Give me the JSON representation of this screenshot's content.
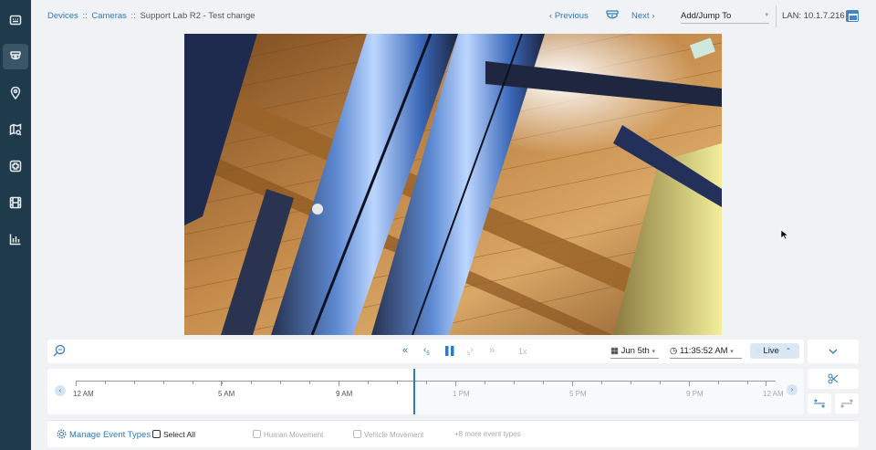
{
  "sidebar": {
    "items": [
      {
        "name": "dashboard",
        "icon": "dashboard-icon"
      },
      {
        "name": "cameras",
        "icon": "camera-icon",
        "active": true
      },
      {
        "name": "locations",
        "icon": "map-pin-icon"
      },
      {
        "name": "map-search",
        "icon": "map-search-icon"
      },
      {
        "name": "health",
        "icon": "medical-plus-icon"
      },
      {
        "name": "footage",
        "icon": "film-icon"
      },
      {
        "name": "analytics",
        "icon": "bar-chart-icon"
      }
    ]
  },
  "header": {
    "breadcrumb": {
      "devices": "Devices",
      "cameras": "Cameras",
      "separator": "::",
      "current": "Support Lab R2 - Test change"
    },
    "previous_label": "Previous",
    "next_label": "Next",
    "jump_label": "Add/Jump To",
    "lan_label": "LAN: 10.1.7.216"
  },
  "controls": {
    "speed": "1x",
    "date": "Jun 5th",
    "time": "11:35:52 AM",
    "live_label": "Live"
  },
  "timeline": {
    "ticks": [
      {
        "label": "12 AM",
        "future": false
      },
      {
        "label": "5 AM",
        "future": false
      },
      {
        "label": "9 AM",
        "future": false
      },
      {
        "label": "1 PM",
        "future": true
      },
      {
        "label": "5 PM",
        "future": true
      },
      {
        "label": "9 PM",
        "future": true
      },
      {
        "label": "12 AM",
        "future": true
      }
    ]
  },
  "events": {
    "manage_label": "Manage Event Types",
    "select_all_label": "Select All",
    "types": [
      "Human Movement",
      "Vehicle Movement"
    ],
    "more_label": "+8 more event types"
  },
  "colors": {
    "sidebar_bg": "#1f3a4a",
    "accent": "#2f7bbd",
    "page_bg": "#f0f2f5"
  }
}
